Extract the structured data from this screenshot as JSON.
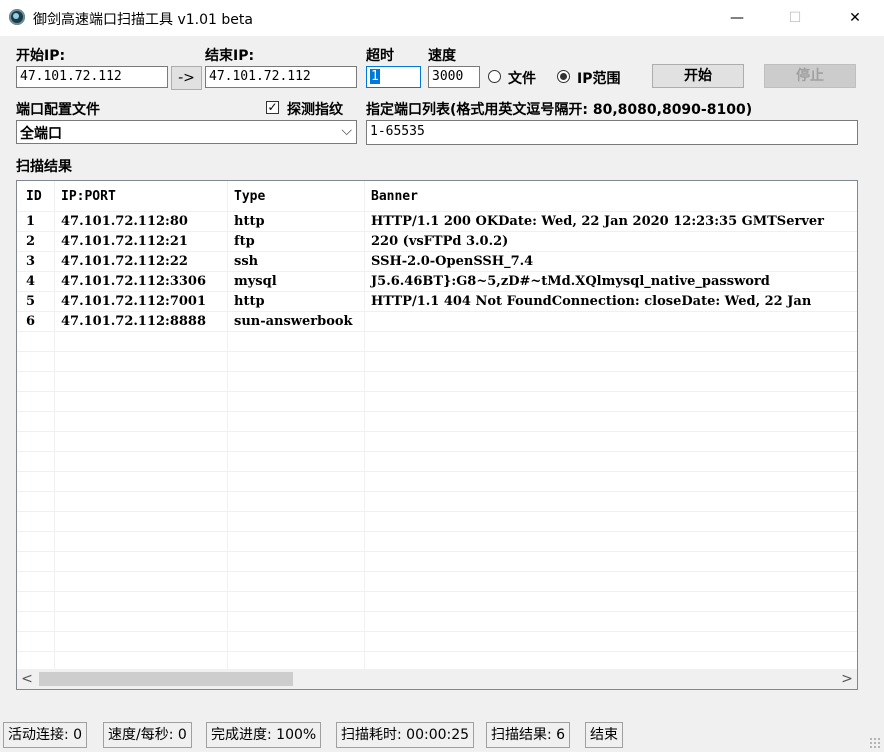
{
  "window": {
    "title": "御剑高速端口扫描工具 v1.01 beta",
    "min_glyph": "—",
    "max_glyph": "☐",
    "close_glyph": "✕"
  },
  "form": {
    "start_ip_label": "开始IP:",
    "start_ip": "47.101.72.112",
    "arrow_label": "->",
    "end_ip_label": "结束IP:",
    "end_ip": "47.101.72.112",
    "timeout_label": "超时",
    "timeout": "1",
    "speed_label": "速度",
    "speed": "3000",
    "radio_file": "文件",
    "radio_range": "IP范围",
    "selected_mode": "IP范围",
    "start_button": "开始",
    "stop_button": "停止",
    "port_config_label": "端口配置文件",
    "port_config_value": "全端口",
    "fingerprint_label": "探测指纹",
    "fingerprint_checked": true,
    "port_list_label": "指定端口列表(格式用英文逗号隔开: 80,8080,8090-8100)",
    "port_list": "1-65535"
  },
  "results": {
    "label": "扫描结果",
    "columns": [
      "ID",
      "IP:PORT",
      "Type",
      "Banner"
    ],
    "rows": [
      [
        "1",
        "47.101.72.112:80",
        "http",
        "HTTP/1.1 200 OKDate: Wed, 22 Jan 2020 12:23:35 GMTServer"
      ],
      [
        "2",
        "47.101.72.112:21",
        "ftp",
        "220 (vsFTPd 3.0.2)"
      ],
      [
        "3",
        "47.101.72.112:22",
        "ssh",
        "SSH-2.0-OpenSSH_7.4"
      ],
      [
        "4",
        "47.101.72.112:3306",
        "mysql",
        "J5.6.46BT}:G8~5,zD#~tMd.XQlmysql_native_password"
      ],
      [
        "5",
        "47.101.72.112:7001",
        "http",
        "HTTP/1.1 404 Not FoundConnection: closeDate: Wed, 22 Jan"
      ],
      [
        "6",
        "47.101.72.112:8888",
        "sun-answerbook",
        ""
      ]
    ],
    "scroll_left": "<",
    "scroll_right": ">"
  },
  "status": {
    "active_connections": "活动连接: 0",
    "speed": "速度/每秒: 0",
    "progress": "完成进度: 100%",
    "elapsed": "扫描耗时: 00:00:25",
    "result_count": "扫描结果: 6",
    "state": "结束"
  }
}
